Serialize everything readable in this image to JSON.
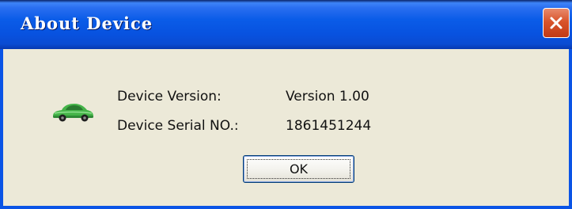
{
  "window": {
    "title": "About Device"
  },
  "device": {
    "icon": "green-car-icon",
    "version_label": "Device Version:",
    "version_value": "Version 1.00",
    "serial_label": "Device Serial NO.:",
    "serial_value": "1861451244"
  },
  "buttons": {
    "ok_label": "OK",
    "close_icon": "close-icon"
  },
  "colors": {
    "titlebar": "#0a5ce8",
    "close_button": "#d9542c",
    "dialog_background": "#ece9d8",
    "car_body": "#45b449"
  }
}
